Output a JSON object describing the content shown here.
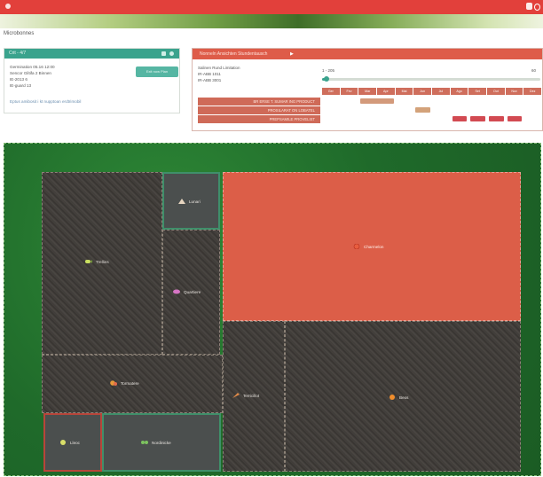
{
  "app": {
    "name": "Microbonnes"
  },
  "status_panel": {
    "title": "Crit - 4/7",
    "button_label": "Exit now Plan",
    "lines": [
      "Germination 05.16 12:00",
      "Sencor Giltifa 2 Binnen",
      "IE-2013  6",
      "IE-guard  13"
    ],
    "link": "Eptus amibosit i kt nupptoan erdtrimobil"
  },
  "schedule_panel": {
    "title": "Nonneln Ansichten Stundentausch",
    "play_icon": "play-icon",
    "info_lines": [
      "Salinen Rund Limitation",
      "IR-ABB 1011",
      "IR-ABB 3001"
    ],
    "range_start": "1 - 205",
    "range_end": "60",
    "slider_value": 0.02,
    "months": [
      "Ger",
      "Fev",
      "Mar",
      "Apr",
      "Mai",
      "Jun",
      "Jul",
      "Ago",
      "Set",
      "Out",
      "Nov",
      "Dez"
    ],
    "activities": [
      {
        "label": "BR ERSE T. SUMAR ING PRODUCT",
        "blocks": [
          {
            "start": 2,
            "end": 3,
            "color": "#d39a7b"
          }
        ]
      },
      {
        "label": "PROSILARAT ON LOBATEL",
        "blocks": [
          {
            "start": 5,
            "end": 5,
            "color": "#d3a27a"
          }
        ]
      },
      {
        "label": "PREPSAMILE PROVELIST",
        "blocks": [
          {
            "start": 7,
            "end": 7,
            "color": "#d24a52"
          },
          {
            "start": 8,
            "end": 8,
            "color": "#d24a52"
          },
          {
            "start": 9,
            "end": 9,
            "color": "#d24a52"
          },
          {
            "start": 10,
            "end": 10,
            "color": "#d24a52"
          }
        ]
      }
    ]
  },
  "plots": [
    {
      "name": "Lunari",
      "icon": "tent-icon",
      "color": "#e7d6c0"
    },
    {
      "name": "Trellins",
      "icon": "corn-icon",
      "color": "#c9df60"
    },
    {
      "name": "Quartiere",
      "icon": "eggplant-icon",
      "color": "#d675c4"
    },
    {
      "name": "Charmelon",
      "icon": "melon-icon",
      "color": "#e85d3f"
    },
    {
      "name": "Tormatere",
      "icon": "pepper-icon",
      "color": "#e79a3a"
    },
    {
      "name": "Terricillot",
      "icon": "carrot-icon",
      "color": "#e08a48"
    },
    {
      "name": "Beos",
      "icon": "squash-icon",
      "color": "#f08d2c"
    },
    {
      "name": "Lleoc",
      "icon": "lemon-icon",
      "color": "#d9df69"
    },
    {
      "name": "Nordinicke",
      "icon": "pea-icon",
      "color": "#7dc35f"
    }
  ]
}
